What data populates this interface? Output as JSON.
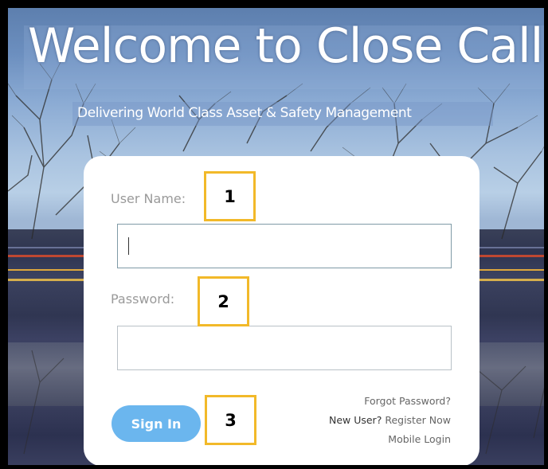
{
  "header": {
    "title": "Welcome to Close Call",
    "subtitle": "Delivering World Class Asset & Safety Management"
  },
  "login": {
    "username_label": "User Name:",
    "username_value": "",
    "password_label": "Password:",
    "password_value": "",
    "signin_label": "Sign In"
  },
  "links": {
    "forgot_password": "Forgot Password?",
    "new_user_prefix": "New User?",
    "register_now": "Register Now",
    "mobile_login": "Mobile Login"
  },
  "callouts": [
    "1",
    "2",
    "3"
  ],
  "colors": {
    "accent_button": "#6bb6ee",
    "callout_border": "#f2b929",
    "card_background": "#ffffff"
  }
}
